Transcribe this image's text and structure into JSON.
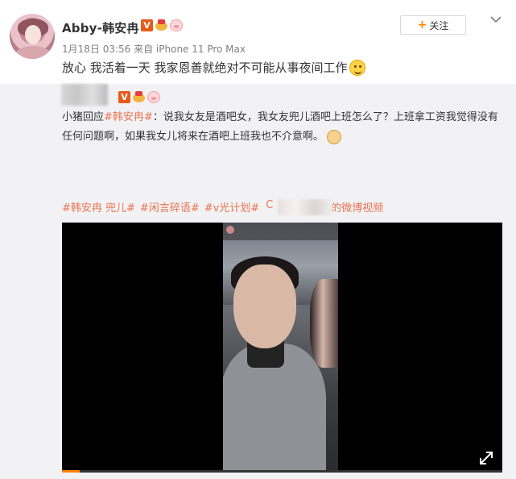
{
  "post": {
    "username": "Abby-韩安冉",
    "meta": "1月18日 03:56 来自 iPhone 11 Pro Max",
    "follow_label": "关注",
    "text": "放心 我活着一天 我家恩善就绝对不可能从事夜间工作"
  },
  "repost": {
    "prefix": "小猪回应",
    "mention": "#韩安冉#",
    "body": "：说我女友是酒吧女，我女友兜儿酒吧上班怎么了？上班拿工资我觉得没有任何问题啊，如果我女儿将来在酒吧上班我也不介意啊。",
    "tags": [
      "#韩安冉 兜儿#",
      "#闲言碎语#",
      "#v光计划#"
    ],
    "tag_prefix": "C",
    "video_suffix": "的微博视频"
  },
  "video": {
    "progress": 0.04
  },
  "icons": {
    "verified": "V",
    "follow_plus": "+"
  }
}
